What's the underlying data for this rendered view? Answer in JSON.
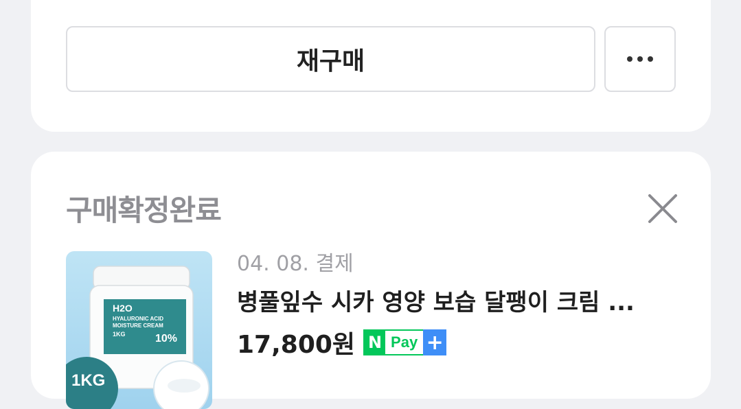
{
  "top_card": {
    "reorder_label": "재구매",
    "more_icon": "more-horizontal-icon"
  },
  "order": {
    "status": "구매확정완료",
    "close_icon": "close-icon",
    "date": "04. 08. 결제",
    "product_name": "병풀잎수 시카 영양 보습 달팽이 크림 ...",
    "price": "17,800원",
    "npay": {
      "n": "N",
      "label": "Pay",
      "plus": "+"
    },
    "thumbnail": {
      "brand": "H2O",
      "line1": "HYALURONIC ACID",
      "line2": "MOISTURE CREAM",
      "size": "1KG",
      "percent": "10%",
      "badge": "1KG"
    }
  },
  "colors": {
    "background": "#f0f1f4",
    "card": "#ffffff",
    "npay_green": "#03c75a",
    "npay_blue": "#3e8ef7",
    "status_gray": "#8e8e93"
  }
}
